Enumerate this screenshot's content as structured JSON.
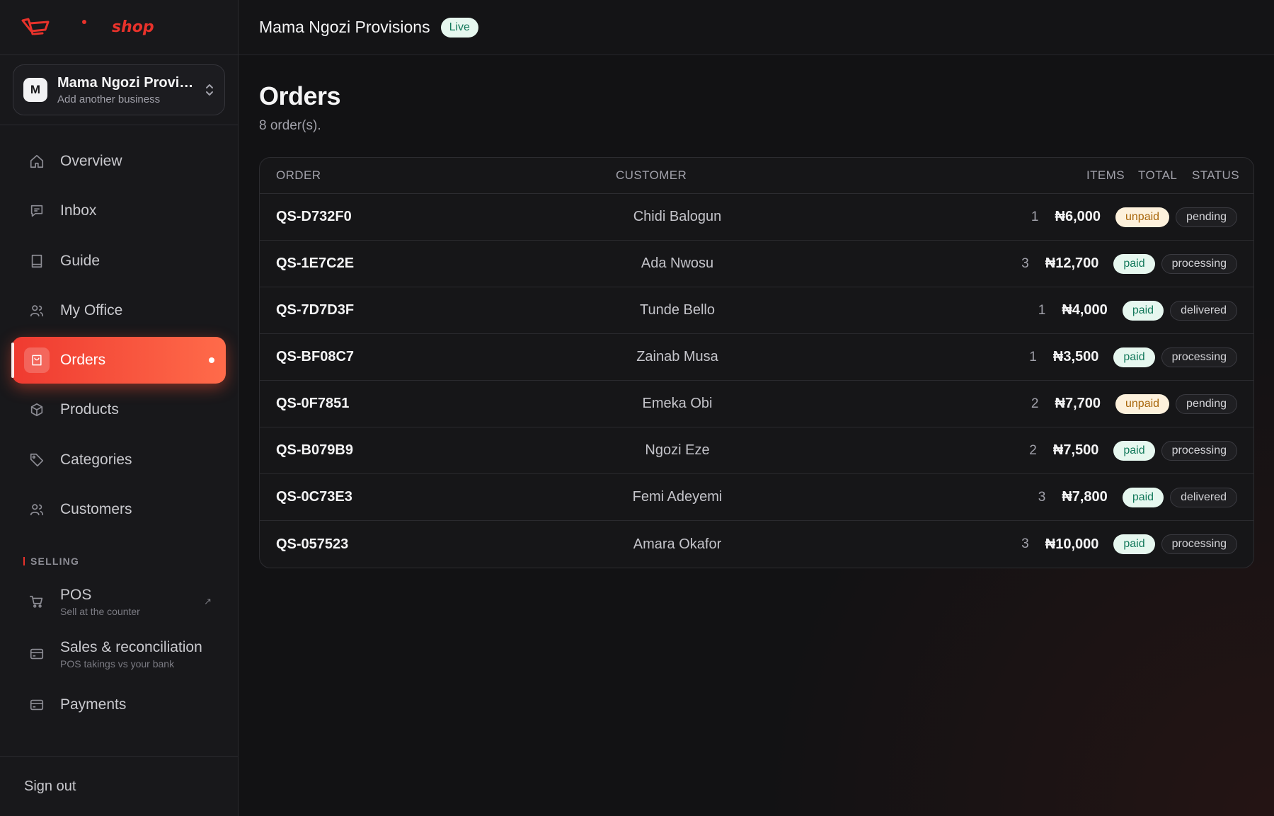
{
  "brand": {
    "word": "shop",
    "accent": "#e8322b"
  },
  "business": {
    "initial": "M",
    "name": "Mama Ngozi Provis...",
    "sub": "Add another business"
  },
  "nav": {
    "overview": "Overview",
    "inbox": "Inbox",
    "guide": "Guide",
    "office": "My Office",
    "orders": "Orders",
    "products": "Products",
    "categories": "Categories",
    "customers": "Customers",
    "selling_label": "SELLING",
    "pos": {
      "label": "POS",
      "sub": "Sell at the counter"
    },
    "sales": {
      "label": "Sales & reconciliation",
      "sub": "POS takings vs your bank"
    },
    "payments": "Payments",
    "signout": "Sign out"
  },
  "topbar": {
    "title": "Mama Ngozi Provisions",
    "badge": "Live"
  },
  "page": {
    "title": "Orders",
    "subtitle": "8 order(s)."
  },
  "table": {
    "headers": {
      "order": "ORDER",
      "customer": "CUSTOMER",
      "items": "ITEMS",
      "total": "TOTAL",
      "status": "STATUS"
    },
    "rows": [
      {
        "order": "QS-D732F0",
        "customer": "Chidi Balogun",
        "items": "1",
        "total": "₦6,000",
        "payment": "unpaid",
        "status": "pending"
      },
      {
        "order": "QS-1E7C2E",
        "customer": "Ada Nwosu",
        "items": "3",
        "total": "₦12,700",
        "payment": "paid",
        "status": "processing"
      },
      {
        "order": "QS-7D7D3F",
        "customer": "Tunde Bello",
        "items": "1",
        "total": "₦4,000",
        "payment": "paid",
        "status": "delivered"
      },
      {
        "order": "QS-BF08C7",
        "customer": "Zainab Musa",
        "items": "1",
        "total": "₦3,500",
        "payment": "paid",
        "status": "processing"
      },
      {
        "order": "QS-0F7851",
        "customer": "Emeka Obi",
        "items": "2",
        "total": "₦7,700",
        "payment": "unpaid",
        "status": "pending"
      },
      {
        "order": "QS-B079B9",
        "customer": "Ngozi Eze",
        "items": "2",
        "total": "₦7,500",
        "payment": "paid",
        "status": "processing"
      },
      {
        "order": "QS-0C73E3",
        "customer": "Femi Adeyemi",
        "items": "3",
        "total": "₦7,800",
        "payment": "paid",
        "status": "delivered"
      },
      {
        "order": "QS-057523",
        "customer": "Amara Okafor",
        "items": "3",
        "total": "₦10,000",
        "payment": "paid",
        "status": "processing"
      }
    ]
  },
  "colors": {
    "active_nav_start": "#ef3a30",
    "active_nav_end": "#ff6b4a",
    "paid": "#13795b",
    "unpaid": "#a8660b"
  }
}
